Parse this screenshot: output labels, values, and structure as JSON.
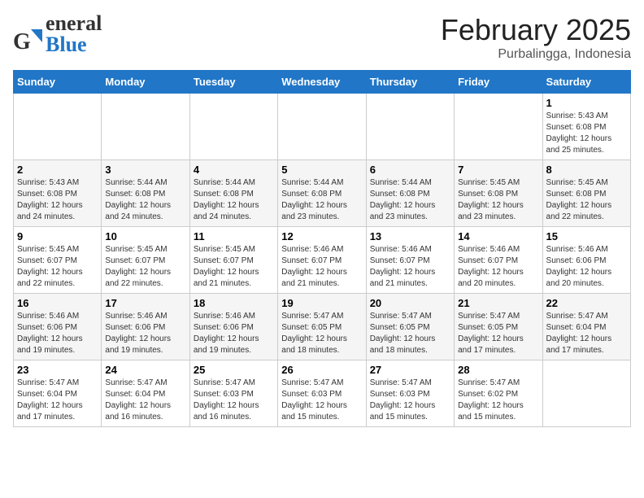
{
  "header": {
    "logo_line1": "General",
    "logo_line2": "Blue",
    "month_title": "February 2025",
    "subtitle": "Purbalingga, Indonesia"
  },
  "weekdays": [
    "Sunday",
    "Monday",
    "Tuesday",
    "Wednesday",
    "Thursday",
    "Friday",
    "Saturday"
  ],
  "weeks": [
    [
      {
        "day": "",
        "info": ""
      },
      {
        "day": "",
        "info": ""
      },
      {
        "day": "",
        "info": ""
      },
      {
        "day": "",
        "info": ""
      },
      {
        "day": "",
        "info": ""
      },
      {
        "day": "",
        "info": ""
      },
      {
        "day": "1",
        "info": "Sunrise: 5:43 AM\nSunset: 6:08 PM\nDaylight: 12 hours and 25 minutes."
      }
    ],
    [
      {
        "day": "2",
        "info": "Sunrise: 5:43 AM\nSunset: 6:08 PM\nDaylight: 12 hours and 24 minutes."
      },
      {
        "day": "3",
        "info": "Sunrise: 5:44 AM\nSunset: 6:08 PM\nDaylight: 12 hours and 24 minutes."
      },
      {
        "day": "4",
        "info": "Sunrise: 5:44 AM\nSunset: 6:08 PM\nDaylight: 12 hours and 24 minutes."
      },
      {
        "day": "5",
        "info": "Sunrise: 5:44 AM\nSunset: 6:08 PM\nDaylight: 12 hours and 23 minutes."
      },
      {
        "day": "6",
        "info": "Sunrise: 5:44 AM\nSunset: 6:08 PM\nDaylight: 12 hours and 23 minutes."
      },
      {
        "day": "7",
        "info": "Sunrise: 5:45 AM\nSunset: 6:08 PM\nDaylight: 12 hours and 23 minutes."
      },
      {
        "day": "8",
        "info": "Sunrise: 5:45 AM\nSunset: 6:08 PM\nDaylight: 12 hours and 22 minutes."
      }
    ],
    [
      {
        "day": "9",
        "info": "Sunrise: 5:45 AM\nSunset: 6:07 PM\nDaylight: 12 hours and 22 minutes."
      },
      {
        "day": "10",
        "info": "Sunrise: 5:45 AM\nSunset: 6:07 PM\nDaylight: 12 hours and 22 minutes."
      },
      {
        "day": "11",
        "info": "Sunrise: 5:45 AM\nSunset: 6:07 PM\nDaylight: 12 hours and 21 minutes."
      },
      {
        "day": "12",
        "info": "Sunrise: 5:46 AM\nSunset: 6:07 PM\nDaylight: 12 hours and 21 minutes."
      },
      {
        "day": "13",
        "info": "Sunrise: 5:46 AM\nSunset: 6:07 PM\nDaylight: 12 hours and 21 minutes."
      },
      {
        "day": "14",
        "info": "Sunrise: 5:46 AM\nSunset: 6:07 PM\nDaylight: 12 hours and 20 minutes."
      },
      {
        "day": "15",
        "info": "Sunrise: 5:46 AM\nSunset: 6:06 PM\nDaylight: 12 hours and 20 minutes."
      }
    ],
    [
      {
        "day": "16",
        "info": "Sunrise: 5:46 AM\nSunset: 6:06 PM\nDaylight: 12 hours and 19 minutes."
      },
      {
        "day": "17",
        "info": "Sunrise: 5:46 AM\nSunset: 6:06 PM\nDaylight: 12 hours and 19 minutes."
      },
      {
        "day": "18",
        "info": "Sunrise: 5:46 AM\nSunset: 6:06 PM\nDaylight: 12 hours and 19 minutes."
      },
      {
        "day": "19",
        "info": "Sunrise: 5:47 AM\nSunset: 6:05 PM\nDaylight: 12 hours and 18 minutes."
      },
      {
        "day": "20",
        "info": "Sunrise: 5:47 AM\nSunset: 6:05 PM\nDaylight: 12 hours and 18 minutes."
      },
      {
        "day": "21",
        "info": "Sunrise: 5:47 AM\nSunset: 6:05 PM\nDaylight: 12 hours and 17 minutes."
      },
      {
        "day": "22",
        "info": "Sunrise: 5:47 AM\nSunset: 6:04 PM\nDaylight: 12 hours and 17 minutes."
      }
    ],
    [
      {
        "day": "23",
        "info": "Sunrise: 5:47 AM\nSunset: 6:04 PM\nDaylight: 12 hours and 17 minutes."
      },
      {
        "day": "24",
        "info": "Sunrise: 5:47 AM\nSunset: 6:04 PM\nDaylight: 12 hours and 16 minutes."
      },
      {
        "day": "25",
        "info": "Sunrise: 5:47 AM\nSunset: 6:03 PM\nDaylight: 12 hours and 16 minutes."
      },
      {
        "day": "26",
        "info": "Sunrise: 5:47 AM\nSunset: 6:03 PM\nDaylight: 12 hours and 15 minutes."
      },
      {
        "day": "27",
        "info": "Sunrise: 5:47 AM\nSunset: 6:03 PM\nDaylight: 12 hours and 15 minutes."
      },
      {
        "day": "28",
        "info": "Sunrise: 5:47 AM\nSunset: 6:02 PM\nDaylight: 12 hours and 15 minutes."
      },
      {
        "day": "",
        "info": ""
      }
    ]
  ]
}
